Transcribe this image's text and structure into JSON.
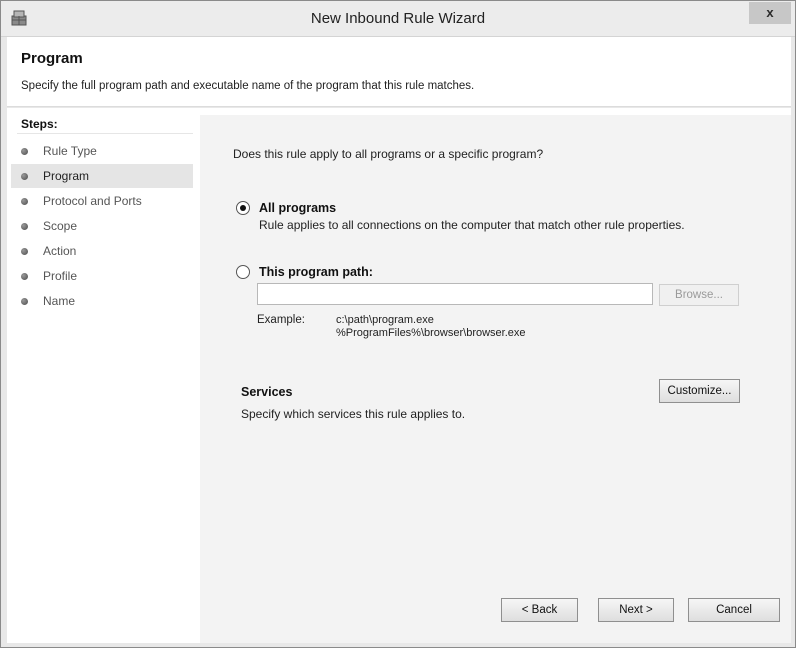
{
  "window": {
    "title": "New Inbound Rule Wizard",
    "close_glyph": "x",
    "app_icon": "firewall-wizard-icon"
  },
  "header": {
    "title": "Program",
    "description": "Specify the full program path and executable name of the program that this rule matches."
  },
  "steps": {
    "label": "Steps:",
    "items": [
      {
        "label": "Rule Type",
        "selected": false
      },
      {
        "label": "Program",
        "selected": true
      },
      {
        "label": "Protocol and Ports",
        "selected": false
      },
      {
        "label": "Scope",
        "selected": false
      },
      {
        "label": "Action",
        "selected": false
      },
      {
        "label": "Profile",
        "selected": false
      },
      {
        "label": "Name",
        "selected": false
      }
    ]
  },
  "content": {
    "question": "Does this rule apply to all programs or a specific program?",
    "all_programs": {
      "label": "All programs",
      "description": "Rule applies to all connections on the computer that match other rule properties.",
      "checked": true
    },
    "program_path": {
      "label": "This program path:",
      "checked": false,
      "value": "",
      "browse_label": "Browse...",
      "example_label": "Example:",
      "example_lines": [
        "c:\\path\\program.exe",
        "%ProgramFiles%\\browser\\browser.exe"
      ]
    },
    "services": {
      "title": "Services",
      "description": "Specify which services this rule applies to.",
      "customize_label": "Customize..."
    }
  },
  "buttons": {
    "back": "< Back",
    "next": "Next >",
    "cancel": "Cancel"
  }
}
